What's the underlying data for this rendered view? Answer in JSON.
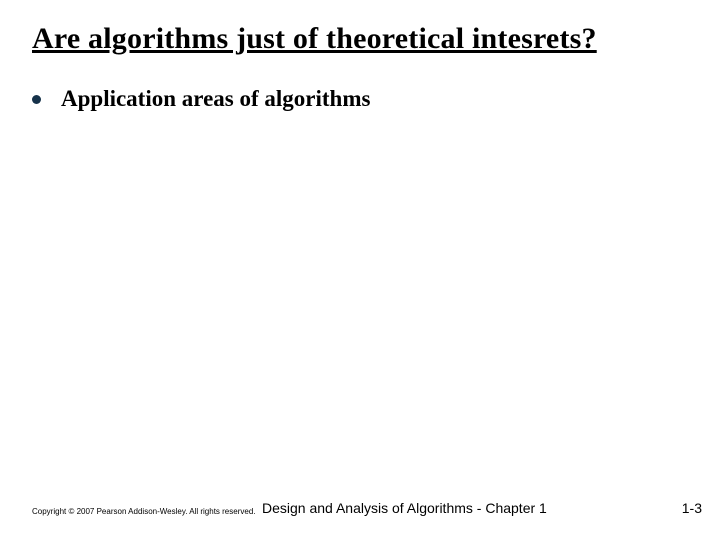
{
  "title": "Are algorithms just of theoretical intesrets?",
  "bullets": [
    {
      "text": "Application areas of algorithms"
    }
  ],
  "footer": {
    "copyright": "Copyright © 2007 Pearson Addison-Wesley. All rights reserved.",
    "center": "Design and Analysis of Algorithms - Chapter 1",
    "page": "1-3"
  }
}
